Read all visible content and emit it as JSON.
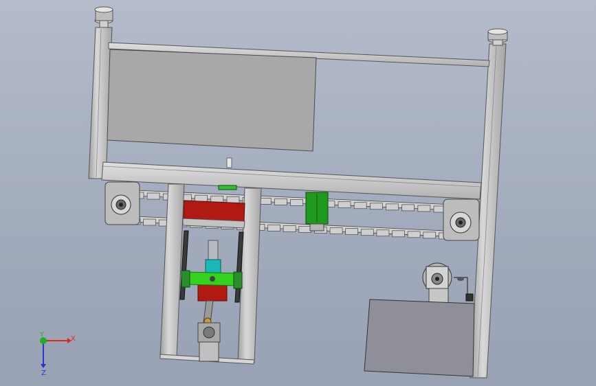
{
  "viewport": {
    "background_top": "#b4bccb",
    "background_bottom": "#98a2b4"
  },
  "colors": {
    "frame_gray": "#c9c9c9",
    "panel_gray": "#a9a9a9",
    "dark_panel": "#8f8f99",
    "chain_gray": "#cfcfcf",
    "red_part": "#b01a12",
    "green_part": "#1f9a1f",
    "bright_green": "#34d11f",
    "cyan_part": "#19b7b7",
    "axis_x": "#e0261e",
    "axis_y": "#21b021",
    "axis_z": "#2436d6"
  },
  "triad": {
    "x_label": "X",
    "y_label": "Y",
    "z_label": "Z"
  }
}
